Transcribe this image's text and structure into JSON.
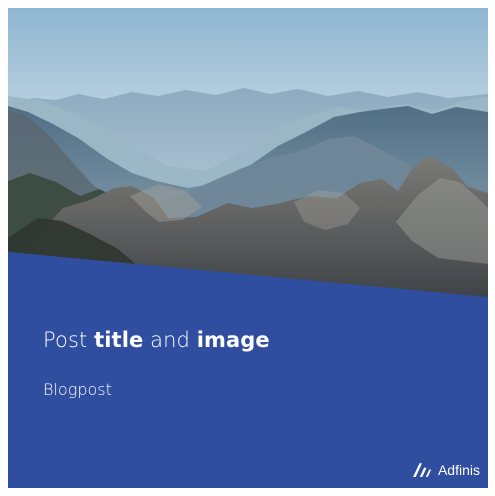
{
  "post": {
    "title_parts": {
      "part1": "Post ",
      "part2": "title",
      "part3": " and ",
      "part4": "image"
    },
    "category": "Blogpost"
  },
  "brand": {
    "name": "Adfinis",
    "logo_icon": "adfinis-logo-icon"
  },
  "colors": {
    "panel_blue": "#2f4ea0",
    "text": "#ffffff",
    "sky_top": "#8fb6d1",
    "sky_mid": "#dfeaee"
  }
}
